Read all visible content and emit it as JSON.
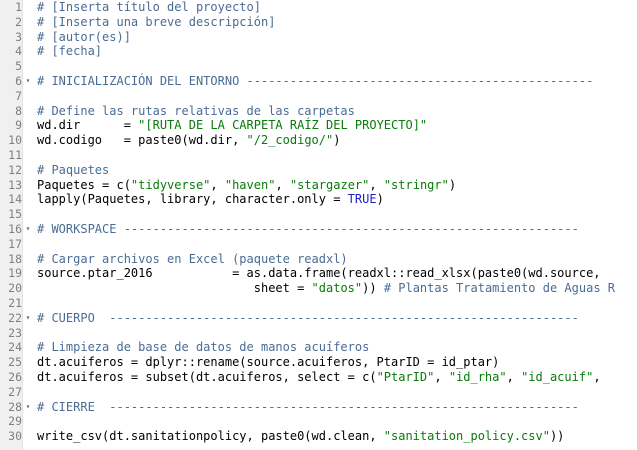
{
  "colors": {
    "comment": "#4a6c94",
    "string": "#0a7a0a",
    "constant": "#2222c4",
    "plain": "#000000",
    "line_number": "#7f7f7f",
    "gutter_bg": "#f0f0f0"
  },
  "fold_icon": "chevron-down-icon",
  "lines": [
    {
      "n": "1",
      "fold": false,
      "tokens": [
        {
          "t": "# [Inserta título del proyecto]",
          "c": "comment"
        }
      ]
    },
    {
      "n": "2",
      "fold": false,
      "tokens": [
        {
          "t": "# [Inserta una breve descripción]",
          "c": "comment"
        }
      ]
    },
    {
      "n": "3",
      "fold": false,
      "tokens": [
        {
          "t": "# [autor(es)]",
          "c": "comment"
        }
      ]
    },
    {
      "n": "4",
      "fold": false,
      "tokens": [
        {
          "t": "# [fecha]",
          "c": "comment"
        }
      ]
    },
    {
      "n": "5",
      "fold": false,
      "tokens": []
    },
    {
      "n": "6",
      "fold": true,
      "tokens": [
        {
          "t": "# INICIALIZACIÓN DEL ENTORNO ------------------------------------------------",
          "c": "comment"
        }
      ]
    },
    {
      "n": "7",
      "fold": false,
      "tokens": []
    },
    {
      "n": "8",
      "fold": false,
      "tokens": [
        {
          "t": "# Define las rutas relativas de las carpetas",
          "c": "comment"
        }
      ]
    },
    {
      "n": "9",
      "fold": false,
      "tokens": [
        {
          "t": "wd.dir      = ",
          "c": "plain"
        },
        {
          "t": "\"[RUTA DE LA CARPETA RAÍZ DEL PROYECTO]\"",
          "c": "string"
        }
      ]
    },
    {
      "n": "10",
      "fold": false,
      "tokens": [
        {
          "t": "wd.codigo   = paste0(wd.dir, ",
          "c": "plain"
        },
        {
          "t": "\"/2_codigo/\"",
          "c": "string"
        },
        {
          "t": ")",
          "c": "plain"
        }
      ]
    },
    {
      "n": "11",
      "fold": false,
      "tokens": []
    },
    {
      "n": "12",
      "fold": false,
      "tokens": [
        {
          "t": "# Paquetes",
          "c": "comment"
        }
      ]
    },
    {
      "n": "13",
      "fold": false,
      "tokens": [
        {
          "t": "Paquetes = c(",
          "c": "plain"
        },
        {
          "t": "\"tidyverse\"",
          "c": "string"
        },
        {
          "t": ", ",
          "c": "plain"
        },
        {
          "t": "\"haven\"",
          "c": "string"
        },
        {
          "t": ", ",
          "c": "plain"
        },
        {
          "t": "\"stargazer\"",
          "c": "string"
        },
        {
          "t": ", ",
          "c": "plain"
        },
        {
          "t": "\"stringr\"",
          "c": "string"
        },
        {
          "t": ")",
          "c": "plain"
        }
      ]
    },
    {
      "n": "14",
      "fold": false,
      "tokens": [
        {
          "t": "lapply(Paquetes, library, character.only = ",
          "c": "plain"
        },
        {
          "t": "TRUE",
          "c": "constant"
        },
        {
          "t": ")",
          "c": "plain"
        }
      ]
    },
    {
      "n": "15",
      "fold": false,
      "tokens": []
    },
    {
      "n": "16",
      "fold": true,
      "tokens": [
        {
          "t": "# WORKSPACE ---------------------------------------------------------------",
          "c": "comment"
        }
      ]
    },
    {
      "n": "17",
      "fold": false,
      "tokens": []
    },
    {
      "n": "18",
      "fold": false,
      "tokens": [
        {
          "t": "# Cargar archivos en Excel (paquete readxl)",
          "c": "comment"
        }
      ]
    },
    {
      "n": "19",
      "fold": false,
      "tokens": [
        {
          "t": "source.ptar_2016           = as.data.frame(readxl::read_xlsx(paste0(wd.source, ",
          "c": "plain"
        }
      ]
    },
    {
      "n": "20",
      "fold": false,
      "tokens": [
        {
          "t": "                              sheet = ",
          "c": "plain"
        },
        {
          "t": "\"datos\"",
          "c": "string"
        },
        {
          "t": ")) ",
          "c": "plain"
        },
        {
          "t": "# Plantas Tratamiento de Aguas R",
          "c": "comment"
        }
      ]
    },
    {
      "n": "21",
      "fold": false,
      "tokens": []
    },
    {
      "n": "22",
      "fold": true,
      "tokens": [
        {
          "t": "# CUERPO  -----------------------------------------------------------------",
          "c": "comment"
        }
      ]
    },
    {
      "n": "23",
      "fold": false,
      "tokens": []
    },
    {
      "n": "24",
      "fold": false,
      "tokens": [
        {
          "t": "# Limpieza de base de datos de manos acuíferos",
          "c": "comment"
        }
      ]
    },
    {
      "n": "25",
      "fold": false,
      "tokens": [
        {
          "t": "dt.acuiferos = dplyr::rename(source.acuiferos, PtarID = id_ptar)",
          "c": "plain"
        }
      ]
    },
    {
      "n": "26",
      "fold": false,
      "tokens": [
        {
          "t": "dt.acuiferos = subset(dt.acuiferos, select = c(",
          "c": "plain"
        },
        {
          "t": "\"PtarID\"",
          "c": "string"
        },
        {
          "t": ", ",
          "c": "plain"
        },
        {
          "t": "\"id_rha\"",
          "c": "string"
        },
        {
          "t": ", ",
          "c": "plain"
        },
        {
          "t": "\"id_acuif\"",
          "c": "string"
        },
        {
          "t": ",",
          "c": "plain"
        }
      ]
    },
    {
      "n": "27",
      "fold": false,
      "tokens": []
    },
    {
      "n": "28",
      "fold": true,
      "tokens": [
        {
          "t": "# CIERRE  -----------------------------------------------------------------",
          "c": "comment"
        }
      ]
    },
    {
      "n": "29",
      "fold": false,
      "tokens": []
    },
    {
      "n": "30",
      "fold": false,
      "tokens": [
        {
          "t": "write_csv(dt.sanitationpolicy, paste0(wd.clean, ",
          "c": "plain"
        },
        {
          "t": "\"sanitation_policy.csv\"",
          "c": "string"
        },
        {
          "t": "))",
          "c": "plain"
        }
      ]
    }
  ]
}
